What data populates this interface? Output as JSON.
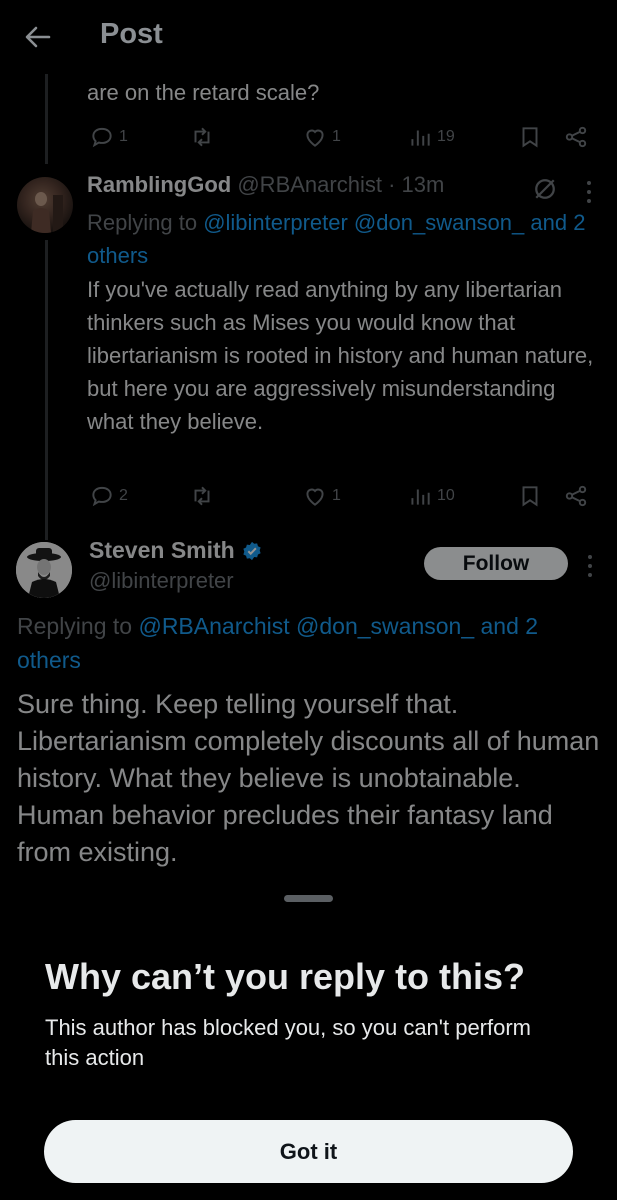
{
  "header": {
    "title": "Post"
  },
  "prev_tweet": {
    "partial_text": "are on the retard scale?",
    "actions": {
      "replies": "1",
      "retweets": "",
      "likes": "1",
      "views": "19"
    }
  },
  "reply_tweet": {
    "display_name": "RamblingGod",
    "handle": "@RBAnarchist",
    "separator": "·",
    "time": "13m",
    "replying_prefix": "Replying to",
    "replying_to": "@libinterpreter @don_swanson_",
    "replying_others": "and 2 others",
    "body": "If you've actually read anything by any libertarian thinkers such as Mises you would know that libertarianism is rooted in history and human nature, but here you are aggressively misunderstanding what they believe.",
    "actions": {
      "replies": "2",
      "retweets": "",
      "likes": "1",
      "views": "10"
    }
  },
  "main_tweet": {
    "display_name": "Steven Smith",
    "handle": "@libinterpreter",
    "follow_label": "Follow",
    "replying_prefix": "Replying to",
    "replying_to": "@RBAnarchist @don_swanson_ and 2 others",
    "body": "Sure thing.  Keep telling yourself that.  Libertarianism completely discounts all of human history.  What they believe is unobtainable.  Human behavior precludes their fantasy land from existing."
  },
  "sheet": {
    "title": "Why can’t you reply to this?",
    "description": "This author has blocked you, so you can't perform this action",
    "button_label": "Got it"
  },
  "colors": {
    "background": "#000000",
    "link": "#1d9bf0",
    "muted": "#71767b",
    "text": "#e7e9ea",
    "button": "#eff3f4"
  }
}
